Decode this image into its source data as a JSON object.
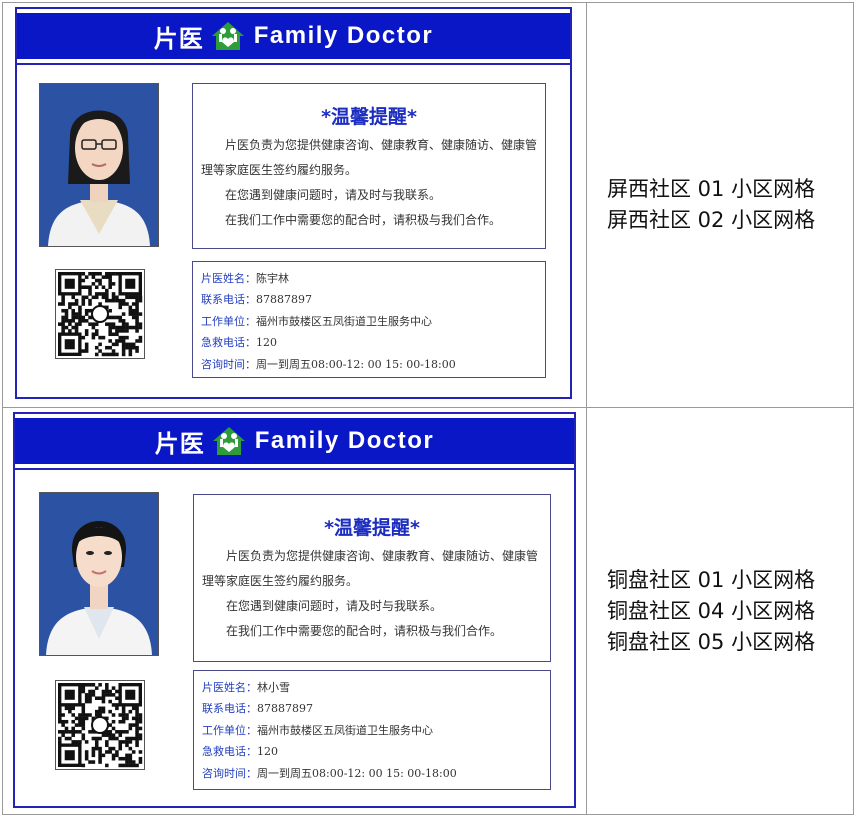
{
  "cards": [
    {
      "brand_cn": "片医",
      "brand_en": "Family Doctor",
      "notice_title": "*温馨提醒*",
      "notice_lines": [
        "片医负责为您提供健康咨询、健康教育、健康随访、健康管理等家庭医生签约履约服务。",
        "在您遇到健康问题时，请及时与我联系。",
        "在我们工作中需要您的配合时，请积极与我们合作。"
      ],
      "info": [
        {
          "label": "片医姓名：",
          "value": "陈宇林"
        },
        {
          "label": "联系电话：",
          "value": "87887897"
        },
        {
          "label": "工作单位：",
          "value": "福州市鼓楼区五凤街道卫生服务中心"
        },
        {
          "label": "急救电话：",
          "value": "120"
        },
        {
          "label": "咨询时间：",
          "value": "周一到周五08:00-12: 00 15: 00-18:00"
        }
      ],
      "areas": [
        "屏西社区 01 小区网格",
        "屏西社区 02 小区网格"
      ]
    },
    {
      "brand_cn": "片医",
      "brand_en": "Family Doctor",
      "notice_title": "*温馨提醒*",
      "notice_lines": [
        "片医负责为您提供健康咨询、健康教育、健康随访、健康管理等家庭医生签约履约服务。",
        "在您遇到健康问题时，请及时与我联系。",
        "在我们工作中需要您的配合时，请积极与我们合作。"
      ],
      "info": [
        {
          "label": "片医姓名：",
          "value": "林小雪"
        },
        {
          "label": "联系电话：",
          "value": "87887897"
        },
        {
          "label": "工作单位：",
          "value": "福州市鼓楼区五凤街道卫生服务中心"
        },
        {
          "label": "急救电话：",
          "value": "120"
        },
        {
          "label": "咨询时间：",
          "value": "周一到周五08:00-12: 00 15: 00-18:00"
        }
      ],
      "areas": [
        "铜盘社区 01 小区网格",
        "铜盘社区 04 小区网格",
        "铜盘社区 05 小区网格"
      ]
    }
  ],
  "colors": {
    "banner_blue": "#0a17c6",
    "border_blue": "#2323b8",
    "logo_green": "#2e9c3a",
    "photo_bg": "#2a4f9c",
    "label_blue": "#2440c0"
  },
  "icons": [
    "family-house-logo-icon",
    "qr-code-icon",
    "doctor-photo"
  ]
}
